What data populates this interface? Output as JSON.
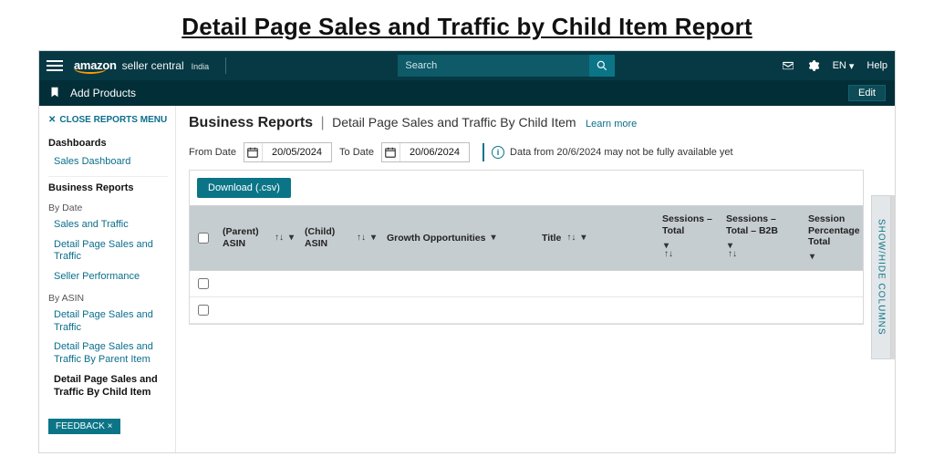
{
  "slide_title": "Detail Page Sales and Traffic by Child Item Report",
  "topbar": {
    "brand_amazon": "amazon",
    "brand_sc": "seller central",
    "brand_region": "India",
    "search_placeholder": "Search",
    "lang": "EN",
    "help": "Help"
  },
  "subbar": {
    "add_products": "Add Products",
    "edit": "Edit"
  },
  "sidebar": {
    "close": "CLOSE REPORTS MENU",
    "dashboards_head": "Dashboards",
    "dashboards_items": [
      "Sales Dashboard"
    ],
    "business_reports_head": "Business Reports",
    "by_date_label": "By Date",
    "by_date_items": [
      "Sales and Traffic",
      "Detail Page Sales and Traffic",
      "Seller Performance"
    ],
    "by_asin_label": "By ASIN",
    "by_asin_items": [
      "Detail Page Sales and Traffic",
      "Detail Page Sales and Traffic By Parent Item",
      "Detail Page Sales and Traffic By Child Item"
    ],
    "active_item": "Detail Page Sales and Traffic By Child Item",
    "feedback": "FEEDBACK ×"
  },
  "crumb": {
    "section": "Business Reports",
    "page": "Detail Page Sales and Traffic By Child Item",
    "learn": "Learn more"
  },
  "filters": {
    "from_label": "From Date",
    "to_label": "To Date",
    "from_value": "20/05/2024",
    "to_value": "20/06/2024",
    "info_text": "Data from 20/6/2024 may not be fully available yet"
  },
  "report": {
    "download_label": "Download (.csv)",
    "columns": {
      "parent_asin": "(Parent) ASIN",
      "child_asin": "(Child) ASIN",
      "growth": "Growth Opportunities",
      "title": "Title",
      "sessions_total": "Sessions – Total",
      "sessions_total_b2b": "Sessions – Total – B2B",
      "session_pct": "Session Percentage Total"
    },
    "rows": [
      {
        "parent_asin": "",
        "child_asin": "",
        "growth": "",
        "title": "",
        "sessions_total": "",
        "sessions_total_b2b": "",
        "session_pct": ""
      },
      {
        "parent_asin": "",
        "child_asin": "",
        "growth": "",
        "title": "",
        "sessions_total": "",
        "sessions_total_b2b": "",
        "session_pct": ""
      }
    ]
  },
  "showhide": "SHOW/HIDE COLUMNS"
}
